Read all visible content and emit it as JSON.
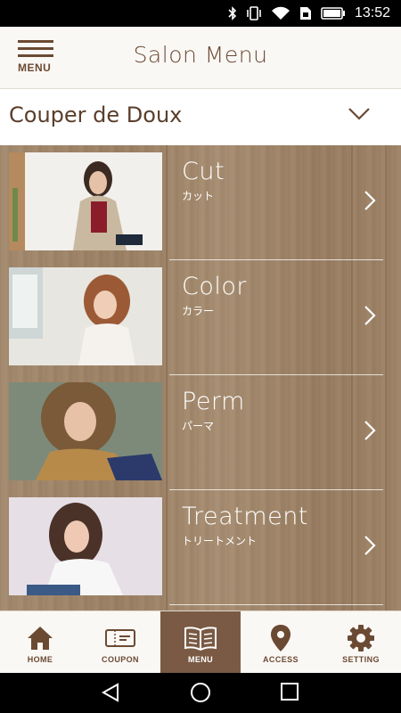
{
  "status_bar": {
    "time": "13:52",
    "icons": [
      "bluetooth-icon",
      "vibrate-icon",
      "wifi-icon",
      "sim-icon",
      "battery-icon"
    ]
  },
  "app_bar": {
    "menu_label": "MENU",
    "title": "Salon Menu"
  },
  "salon_selector": {
    "name": "Couper de Doux"
  },
  "menu_items": [
    {
      "title": "Cut",
      "subtitle": "カット"
    },
    {
      "title": "Color",
      "subtitle": "カラー"
    },
    {
      "title": "Perm",
      "subtitle": "パーマ"
    },
    {
      "title": "Treatment",
      "subtitle": "トリートメント"
    }
  ],
  "bottom_nav": [
    {
      "label": "HOME",
      "icon": "home-icon",
      "active": false
    },
    {
      "label": "COUPON",
      "icon": "coupon-icon",
      "active": false
    },
    {
      "label": "MENU",
      "icon": "book-icon",
      "active": true
    },
    {
      "label": "ACCESS",
      "icon": "map-pin-icon",
      "active": false
    },
    {
      "label": "SETTING",
      "icon": "gear-icon",
      "active": false
    }
  ],
  "colors": {
    "brand_brown": "#6b4a33",
    "active_tab": "#7a5a44",
    "wood": "#a08568"
  }
}
